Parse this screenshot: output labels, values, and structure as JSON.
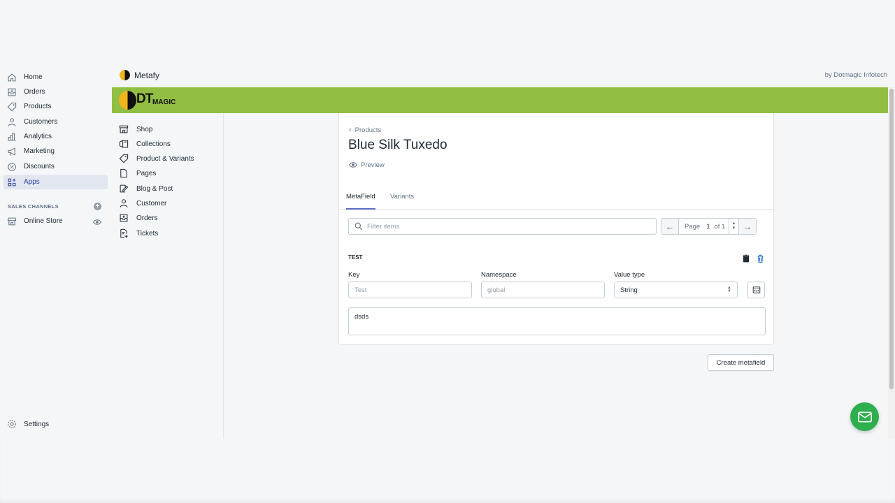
{
  "admin_nav": {
    "items": [
      {
        "label": "Home",
        "icon": "home-icon",
        "active": false
      },
      {
        "label": "Orders",
        "icon": "orders-icon",
        "active": false
      },
      {
        "label": "Products",
        "icon": "tag-icon",
        "active": false
      },
      {
        "label": "Customers",
        "icon": "person-icon",
        "active": false
      },
      {
        "label": "Analytics",
        "icon": "bar-chart-icon",
        "active": false
      },
      {
        "label": "Marketing",
        "icon": "megaphone-icon",
        "active": false
      },
      {
        "label": "Discounts",
        "icon": "discount-icon",
        "active": false
      },
      {
        "label": "Apps",
        "icon": "apps-icon",
        "active": true
      }
    ],
    "sales_channels_label": "SALES CHANNELS",
    "online_store_label": "Online Store",
    "settings_label": "Settings"
  },
  "app": {
    "title": "Metafy",
    "by_text": "by Dotmagic Infotech",
    "logo_text": "DT",
    "logo_small": "MAGIC",
    "accent_color": "#92be43"
  },
  "app_nav": {
    "items": [
      {
        "label": "Shop",
        "icon": "shop-icon"
      },
      {
        "label": "Collections",
        "icon": "collections-icon"
      },
      {
        "label": "Product & Variants",
        "icon": "tag-icon"
      },
      {
        "label": "Pages",
        "icon": "page-icon"
      },
      {
        "label": "Blog & Post",
        "icon": "blog-icon"
      },
      {
        "label": "Customer",
        "icon": "person-icon"
      },
      {
        "label": "Orders",
        "icon": "orders-icon"
      },
      {
        "label": "Tickets",
        "icon": "tickets-icon"
      }
    ]
  },
  "product": {
    "breadcrumb": "Products",
    "title": "Blue Silk Tuxedo",
    "preview_label": "Preview"
  },
  "tabs": [
    {
      "label": "MetaField",
      "active": true
    },
    {
      "label": "Variants",
      "active": false
    }
  ],
  "filter": {
    "placeholder": "Filter items"
  },
  "pager": {
    "page_label": "Page",
    "page": "1",
    "of_label": "of 1"
  },
  "metafield": {
    "title": "TEST",
    "key_label": "Key",
    "key_placeholder": "Test",
    "namespace_label": "Namespace",
    "namespace_placeholder": "global",
    "value_type_label": "Value type",
    "value_type": "String",
    "value": "dsds"
  },
  "create_button": "Create metafield"
}
